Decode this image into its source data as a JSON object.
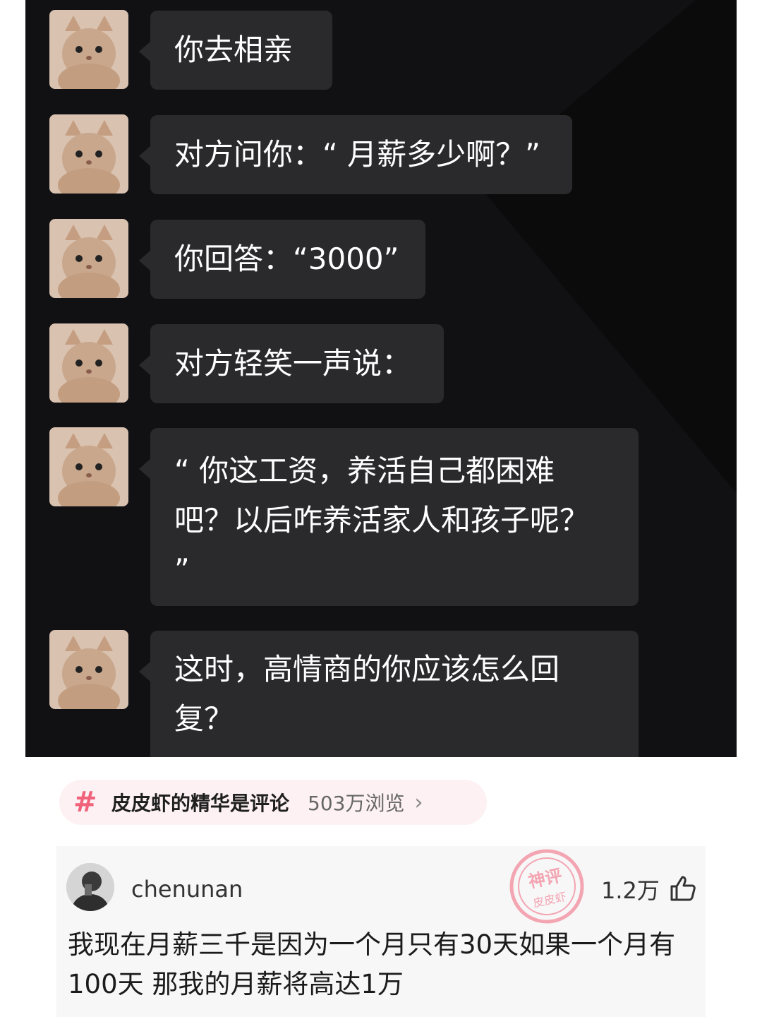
{
  "chat": {
    "messages": [
      {
        "text": "你去相亲"
      },
      {
        "text": "对方问你：“ 月薪多少啊？”"
      },
      {
        "text": "你回答：“3000”"
      },
      {
        "text": "对方轻笑一声说："
      },
      {
        "text": "“ 你这工资，养活自己都困难\n吧？以后咋养活家人和孩子呢？\n”"
      },
      {
        "text": "这时，高情商的你应该怎么回\n复？"
      }
    ]
  },
  "topic": {
    "icon": "hash-icon",
    "name": "皮皮虾的精华是评论",
    "views": "503万浏览",
    "chevron": "›"
  },
  "comment": {
    "username": "chenunan",
    "likes": "1.2万",
    "stamp_lines": [
      "神评",
      "皮皮虾"
    ],
    "text": "我现在月薪三千是因为一个月只有30天如果一个月有100天 那我的月薪将高达1万"
  },
  "colors": {
    "chat_bg": "#111113",
    "bubble": "#2a2a2d",
    "accent": "#f0637b"
  }
}
